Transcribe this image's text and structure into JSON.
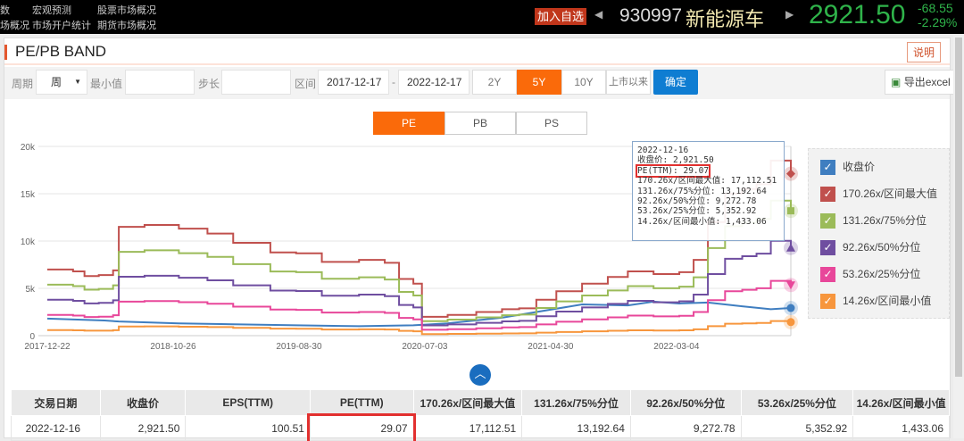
{
  "topnav": {
    "row1": [
      "宏观预测",
      "股票市场概况"
    ],
    "row2": [
      "市场开户统计",
      "期货市场概况"
    ],
    "cut1": "数",
    "cut2": "场概况"
  },
  "quote": {
    "add_watch": "加入自选",
    "code": "930997",
    "name": "新能源车",
    "price": "2921.50",
    "change": "-68.55",
    "change_pct": "-2.29%"
  },
  "panel": {
    "title": "PE/PB BAND",
    "help": "说明"
  },
  "toolbar": {
    "period_label": "周期",
    "period_value": "周",
    "min_label": "最小值",
    "min_value": "",
    "step_label": "步长",
    "step_value": "",
    "range_label": "区间",
    "start": "2017-12-17",
    "sep": "-",
    "end": "2022-12-17",
    "ranges": [
      "2Y",
      "5Y",
      "10Y",
      "上市以来"
    ],
    "active_range": "5Y",
    "confirm": "确定",
    "export": "导出excel"
  },
  "tabs": {
    "items": [
      "PE",
      "PB",
      "PS"
    ],
    "active": "PE"
  },
  "tooltip": {
    "date": "2022-12-16",
    "close": "收盘价: 2,921.50",
    "pe": "PE(TTM): 29.07",
    "l1": "170.26x/区间最大值: 17,112.51",
    "l2": "131.26x/75%分位: 13,192.64",
    "l3": "92.26x/50%分位: 9,272.78",
    "l4": "53.26x/25%分位: 5,352.92",
    "l5": "14.26x/区间最小值: 1,433.06"
  },
  "chart_data": {
    "type": "line",
    "x_unit": "week index from 2017-12-22",
    "x_range": [
      0,
      260
    ],
    "xticks": [
      {
        "w": 0,
        "label": "2017-12-22"
      },
      {
        "w": 44,
        "label": "2018-10-26"
      },
      {
        "w": 88,
        "label": "2019-08-30"
      },
      {
        "w": 132,
        "label": "2020-07-03"
      },
      {
        "w": 176,
        "label": "2021-04-30"
      },
      {
        "w": 220,
        "label": "2022-03-04"
      }
    ],
    "ylim": [
      0,
      20000
    ],
    "yticks": [
      {
        "v": 0,
        "label": "0"
      },
      {
        "v": 5000,
        "label": "5k"
      },
      {
        "v": 10000,
        "label": "10k"
      },
      {
        "v": 15000,
        "label": "15k"
      },
      {
        "v": 20000,
        "label": "20k"
      }
    ],
    "eps_weeks": [
      0,
      9,
      13,
      18,
      23,
      25,
      34,
      46,
      56,
      65,
      78,
      87,
      96,
      109,
      118,
      123,
      128,
      131,
      140,
      150,
      159,
      165,
      171,
      178,
      187,
      196,
      203,
      212,
      221,
      226,
      231,
      237,
      243,
      248,
      253,
      260
    ],
    "eps": [
      41.1,
      39.9,
      37.0,
      37.6,
      40.5,
      67.5,
      68.7,
      66.4,
      63.4,
      57.6,
      51.7,
      51.1,
      45.8,
      47.0,
      45.2,
      35.2,
      32.3,
      11.7,
      12.9,
      14.7,
      16.4,
      17.0,
      22.3,
      27.6,
      32.3,
      36.4,
      39.9,
      38.2,
      39.4,
      47.0,
      70.5,
      88.1,
      91.0,
      94.0,
      108.7,
      100.51
    ],
    "close_weeks": [
      0,
      20,
      25,
      46,
      65,
      87,
      109,
      128,
      140,
      159,
      171,
      187,
      203,
      212,
      221,
      231,
      243,
      253,
      260
    ],
    "close": [
      1800,
      1600,
      1500,
      1300,
      1200,
      1100,
      1000,
      1100,
      1300,
      1900,
      2500,
      3300,
      3200,
      3600,
      3400,
      3500,
      3100,
      2800,
      2921.5
    ],
    "series": [
      {
        "name": "收盘价",
        "color": "#3f7ec0",
        "type": "close",
        "marker": "circle"
      },
      {
        "name": "170.26x/区间最大值",
        "multiple": 170.26,
        "color": "#c0504d",
        "marker": "diamond"
      },
      {
        "name": "131.26x/75%分位",
        "multiple": 131.26,
        "color": "#9bbb59",
        "marker": "square"
      },
      {
        "name": "92.26x/50%分位",
        "multiple": 92.26,
        "color": "#6f4ea0",
        "marker": "triangle"
      },
      {
        "name": "53.26x/25%分位",
        "multiple": 53.26,
        "color": "#e8479a",
        "marker": "triangle-down"
      },
      {
        "name": "14.26x/区间最小值",
        "multiple": 14.26,
        "color": "#f7963d",
        "marker": "circle"
      }
    ]
  },
  "table": {
    "headers": [
      "交易日期",
      "收盘价",
      "EPS(TTM)",
      "PE(TTM)",
      "170.26x/区间最大值",
      "131.26x/75%分位",
      "92.26x/50%分位",
      "53.26x/25%分位",
      "14.26x/区间最小值"
    ],
    "rows": [
      [
        "2022-12-16",
        "2,921.50",
        "100.51",
        "29.07",
        "17,112.51",
        "13,192.64",
        "9,272.78",
        "5,352.92",
        "1,433.06"
      ]
    ]
  }
}
